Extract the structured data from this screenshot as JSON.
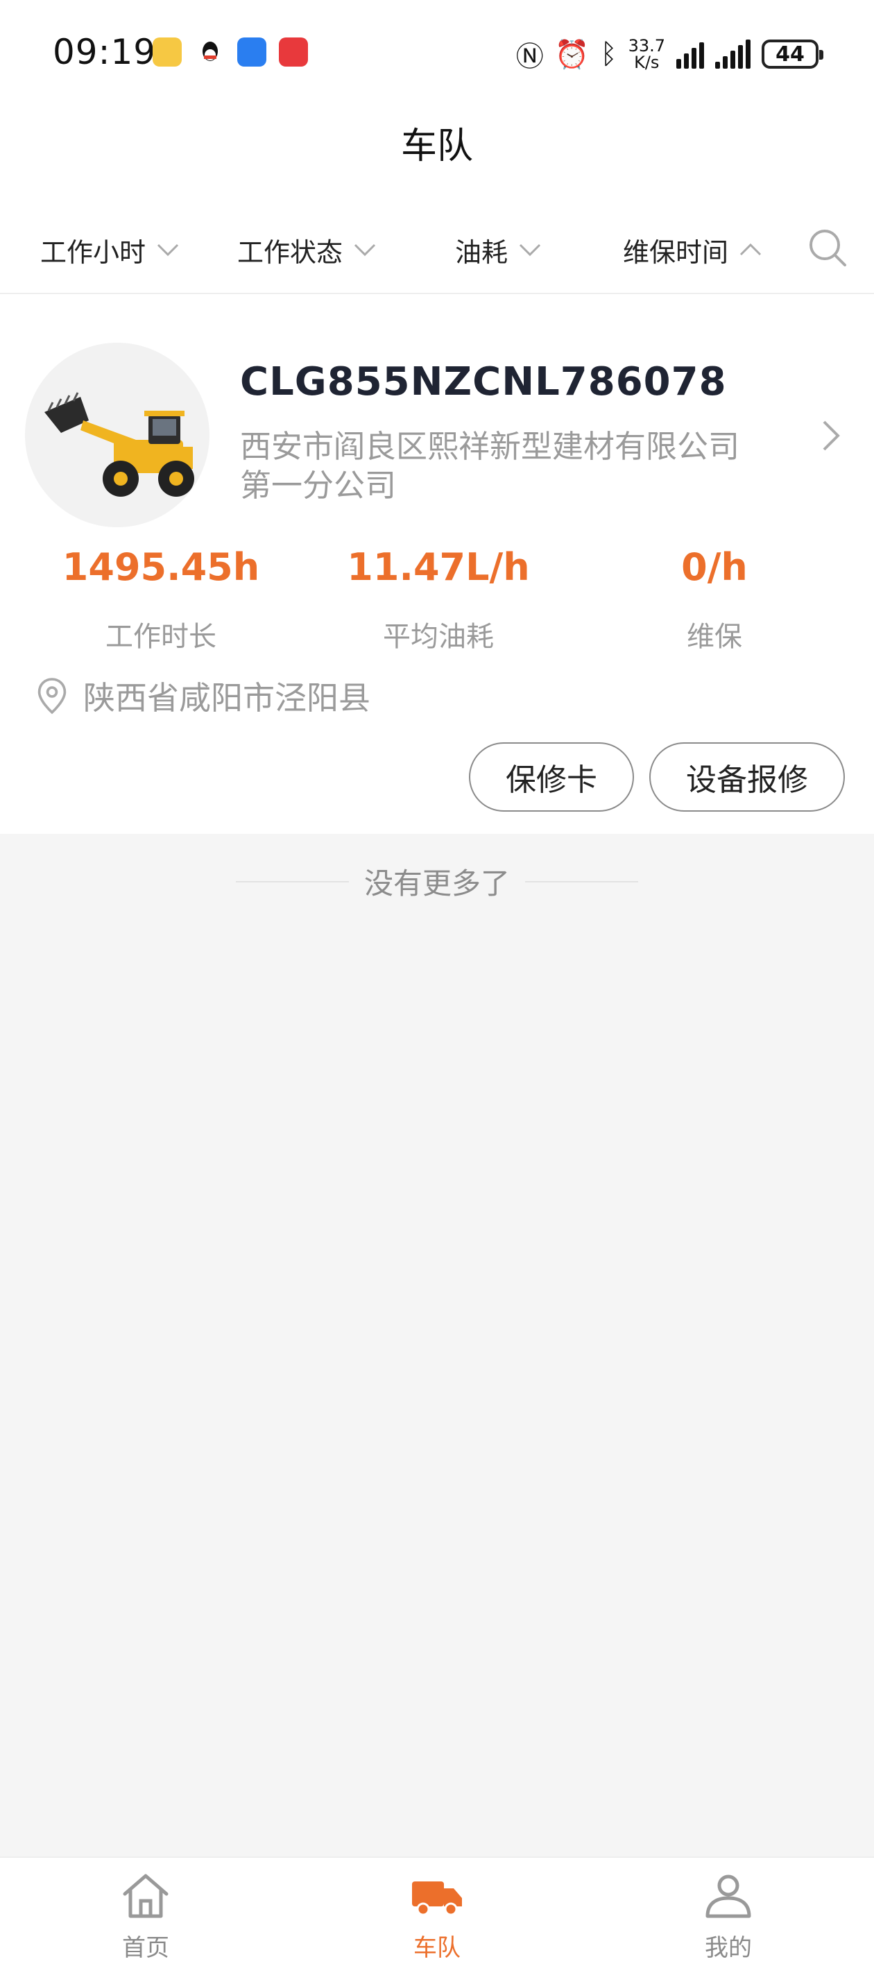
{
  "status_bar": {
    "time": "09:19",
    "speed_top": "33.7",
    "speed_bottom": "K/s",
    "battery": "44"
  },
  "header": {
    "title": "车队"
  },
  "filters": [
    {
      "label": "工作小时",
      "state": "collapsed"
    },
    {
      "label": "工作状态",
      "state": "collapsed"
    },
    {
      "label": "油耗",
      "state": "collapsed"
    },
    {
      "label": "维保时间",
      "state": "expanded"
    }
  ],
  "vehicle": {
    "id": "CLG855NZCNL786078",
    "company": "西安市阎良区熙祥新型建材有限公司第一分公司",
    "stats": [
      {
        "value": "1495.45h",
        "label": "工作时长"
      },
      {
        "value": "11.47L/h",
        "label": "平均油耗"
      },
      {
        "value": "0/h",
        "label": "维保"
      }
    ],
    "location": "陕西省咸阳市泾阳县",
    "buttons": {
      "warranty": "保修卡",
      "repair": "设备报修"
    }
  },
  "list_end": "没有更多了",
  "nav": [
    {
      "label": "首页",
      "active": false
    },
    {
      "label": "车队",
      "active": true
    },
    {
      "label": "我的",
      "active": false
    }
  ],
  "colors": {
    "accent": "#ec6f2b",
    "muted": "#9a9a9a",
    "background": "#f5f5f5"
  }
}
